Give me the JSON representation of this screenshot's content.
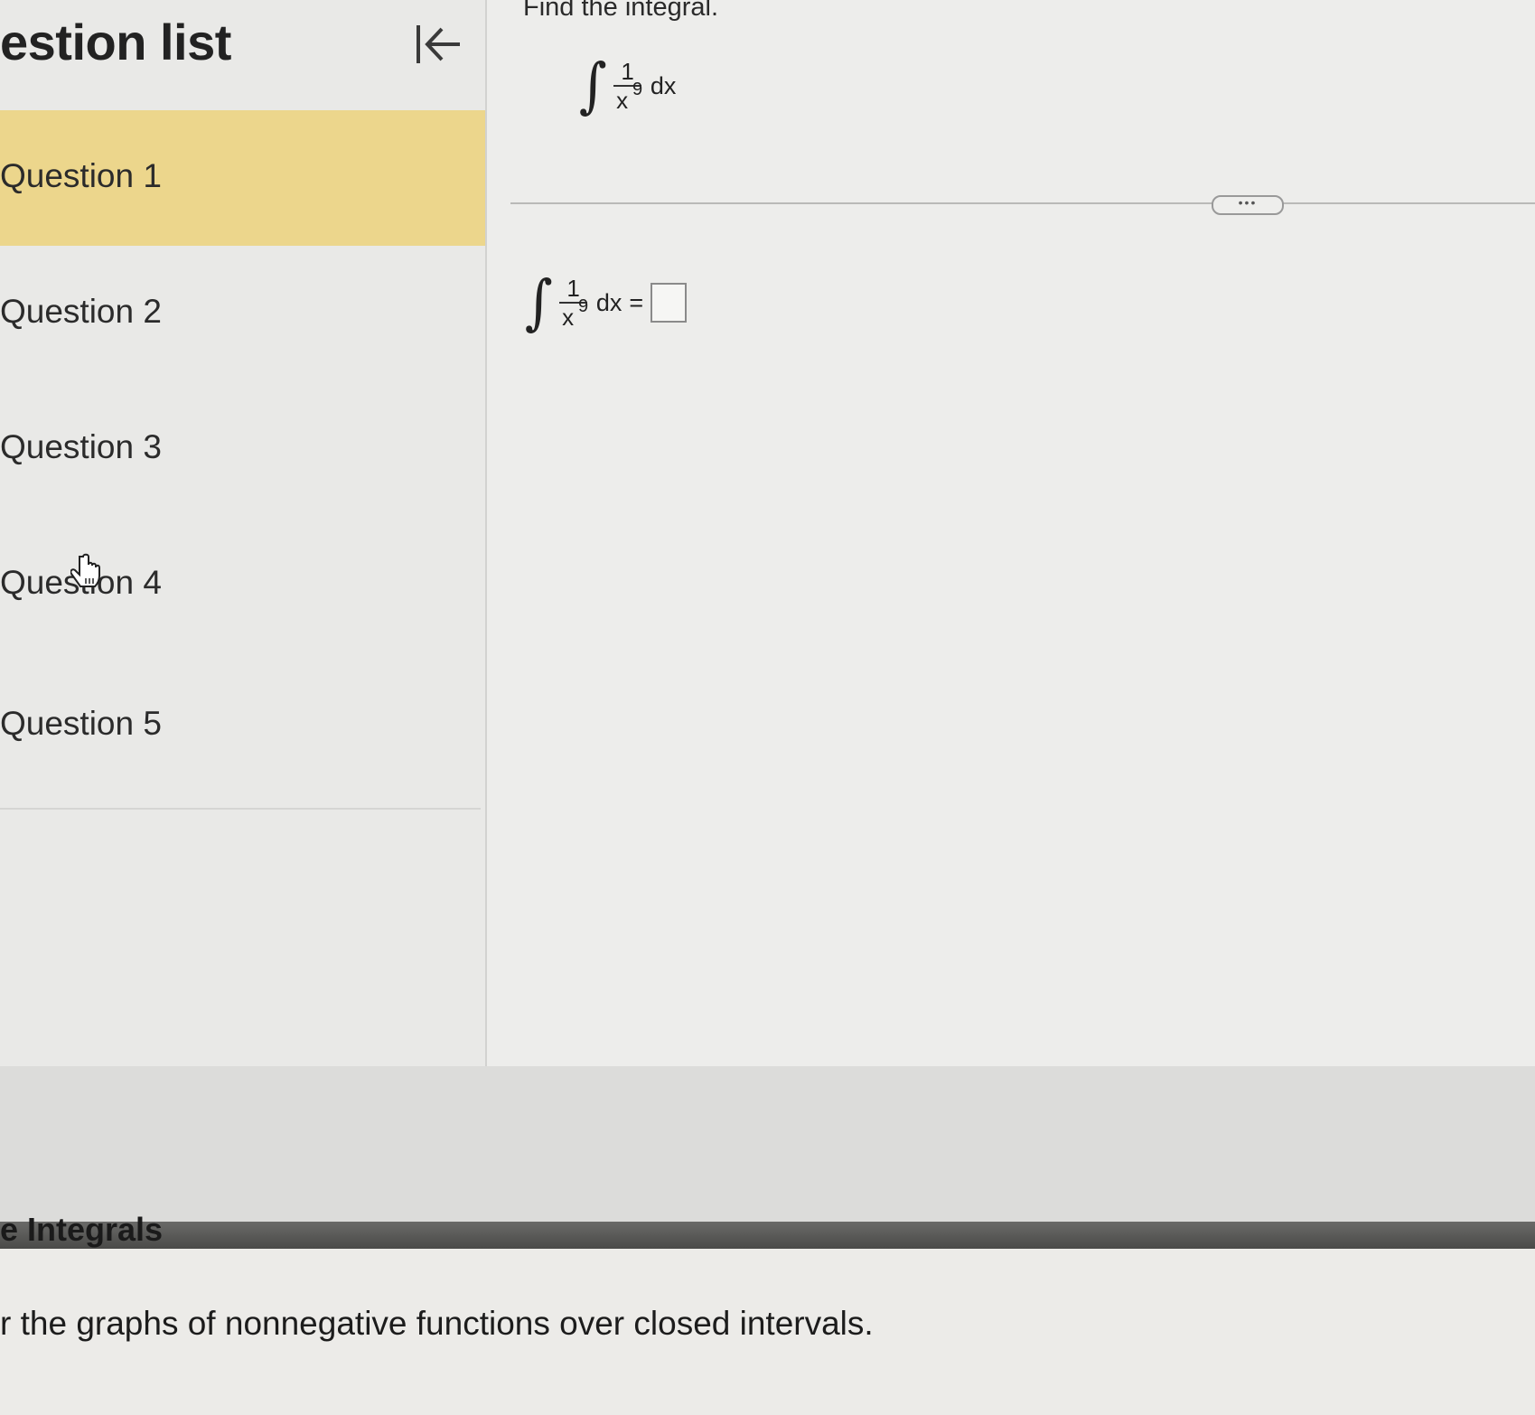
{
  "sidebar": {
    "title": "estion list",
    "collapse_icon": "collapse-left-icon",
    "questions": [
      {
        "label": "Question 1",
        "active": true
      },
      {
        "label": "Question 2",
        "active": false
      },
      {
        "label": "Question 3",
        "active": false
      },
      {
        "label": "Question 4",
        "active": false
      },
      {
        "label": "Question 5",
        "active": false
      }
    ],
    "active_color": "#ecd68c"
  },
  "main": {
    "instruction": "Find the integral.",
    "problem": {
      "numerator": "1",
      "base": "x",
      "exponent": "9",
      "differential": "dx"
    },
    "answer": {
      "numerator": "1",
      "base": "x",
      "exponent": "9",
      "differential": "dx",
      "equals": "=",
      "value": ""
    },
    "more_button": "•••"
  },
  "paper": {
    "heading": "e Integrals",
    "text": "r the graphs of nonnegative functions over closed intervals."
  }
}
